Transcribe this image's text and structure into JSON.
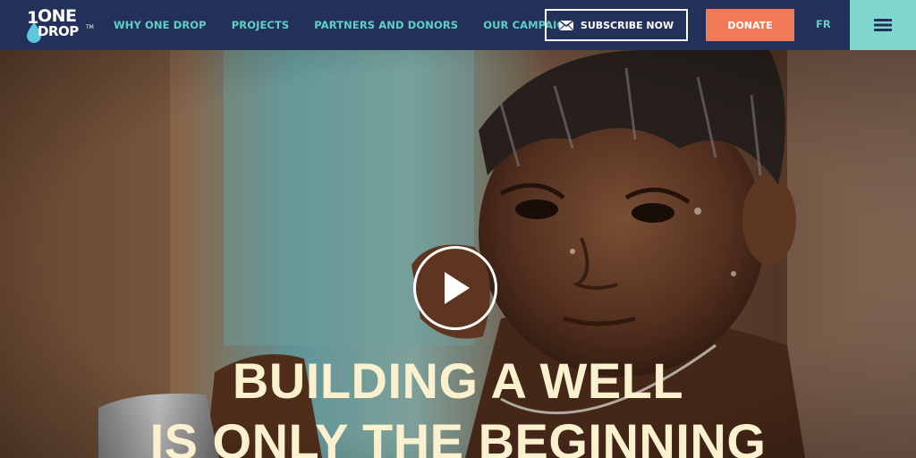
{
  "brand": {
    "num": "1",
    "line1": "ONE",
    "line2": "DROP",
    "tm": "TM"
  },
  "nav": {
    "items": [
      {
        "label": "WHY ONE DROP"
      },
      {
        "label": "PROJECTS"
      },
      {
        "label": "PARTNERS AND DONORS"
      },
      {
        "label": "OUR CAMPAIGN"
      }
    ]
  },
  "header": {
    "subscribe_label": "SUBSCRIBE NOW",
    "donate_label": "DONATE",
    "language_label": "FR"
  },
  "hero": {
    "headline_line1": "BUILDING A WELL",
    "headline_line2": "IS ONLY THE BEGINNING"
  },
  "icons": {
    "logo": "water-drop-logo",
    "subscribe": "envelope-icon",
    "play": "play-icon",
    "menu": "hamburger-menu-icon"
  },
  "colors": {
    "header_bg": "#22305a",
    "nav_text": "#5fd0c3",
    "donate_bg": "#f07a58",
    "menu_bg": "#7fd7d0",
    "headline": "#fbf1cf"
  }
}
